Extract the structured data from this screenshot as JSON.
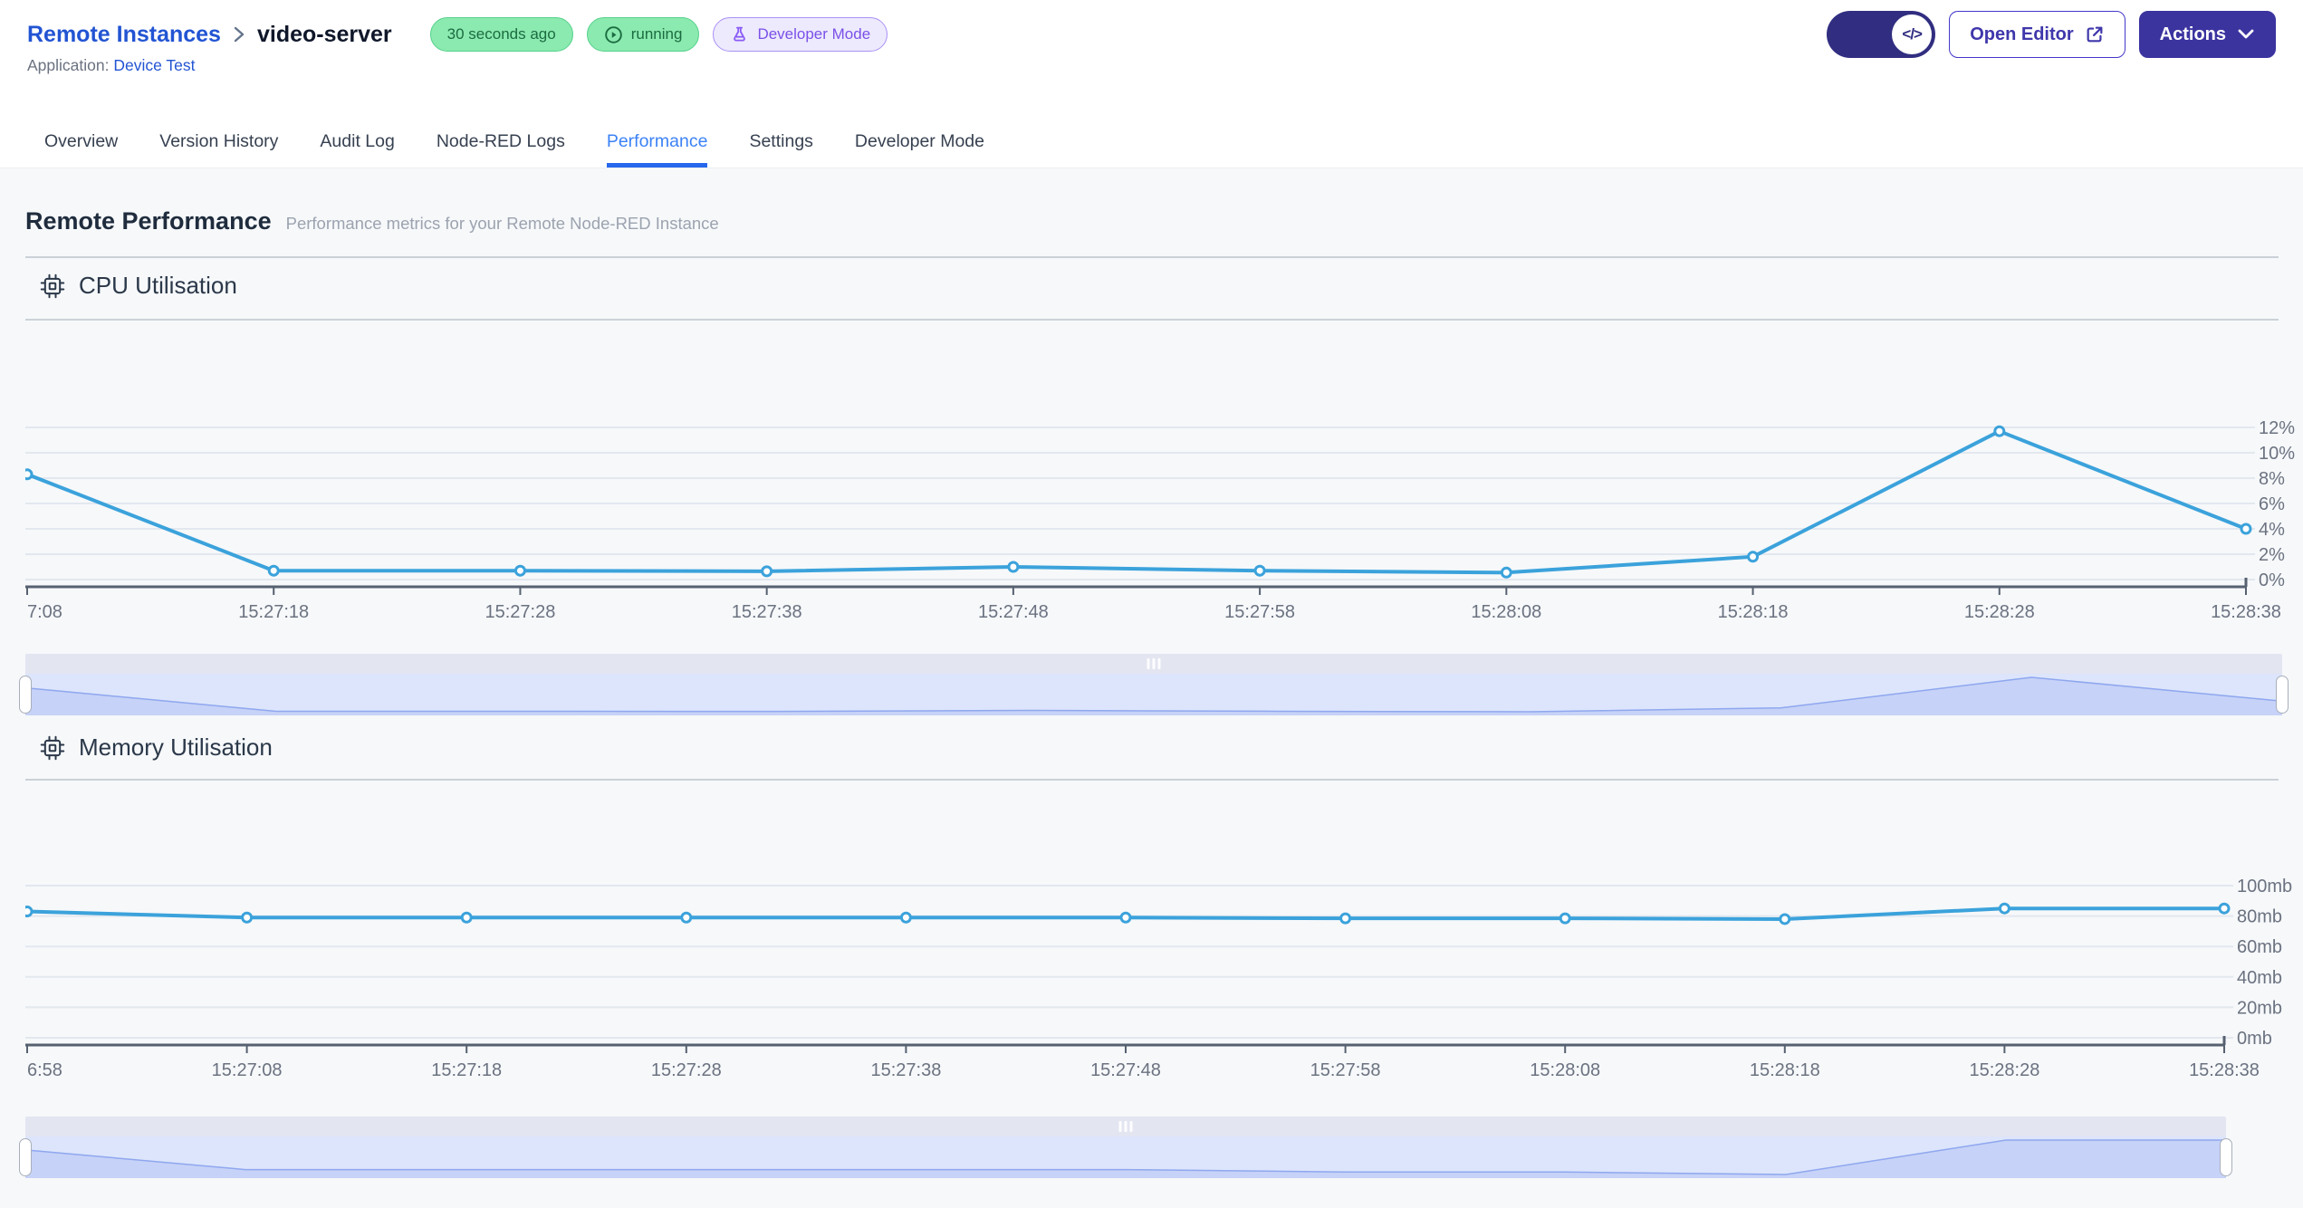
{
  "header": {
    "breadcrumb": {
      "parent": "Remote Instances",
      "current": "video-server"
    },
    "badges": {
      "last_seen": "30 seconds ago",
      "status": "running",
      "mode": "Developer Mode"
    },
    "application": {
      "label": "Application:",
      "name": "Device Test"
    },
    "controls": {
      "editor_toggle_icon": "</>",
      "open_editor": "Open Editor",
      "actions": "Actions"
    }
  },
  "tabs": [
    {
      "label": "Overview",
      "active": false
    },
    {
      "label": "Version History",
      "active": false
    },
    {
      "label": "Audit Log",
      "active": false
    },
    {
      "label": "Node-RED Logs",
      "active": false
    },
    {
      "label": "Performance",
      "active": true
    },
    {
      "label": "Settings",
      "active": false
    },
    {
      "label": "Developer Mode",
      "active": false
    }
  ],
  "page": {
    "title": "Remote Performance",
    "subtitle": "Performance metrics for your Remote Node-RED Instance"
  },
  "chart_data": [
    {
      "id": "cpu",
      "type": "line",
      "title": "CPU Utilisation",
      "unit": "%",
      "ylim": [
        0,
        12
      ],
      "y_ticks": [
        0,
        2,
        4,
        6,
        8,
        10,
        12
      ],
      "x": [
        "7:08",
        "15:27:18",
        "15:27:28",
        "15:27:38",
        "15:27:48",
        "15:27:58",
        "15:28:08",
        "15:28:18",
        "15:28:28",
        "15:28:38"
      ],
      "values": [
        8.3,
        0.7,
        0.7,
        0.65,
        1.0,
        0.7,
        0.55,
        1.8,
        11.7,
        4.0
      ],
      "grid": true,
      "legend": "none",
      "line_color": "#3BA2DB"
    },
    {
      "id": "memory",
      "type": "line",
      "title": "Memory Utilisation",
      "unit": "mb",
      "ylim": [
        0,
        100
      ],
      "y_ticks": [
        0,
        20,
        40,
        60,
        80,
        100
      ],
      "x": [
        "6:58",
        "15:27:08",
        "15:27:18",
        "15:27:28",
        "15:27:38",
        "15:27:48",
        "15:27:58",
        "15:28:08",
        "15:28:18",
        "15:28:28",
        "15:28:38"
      ],
      "values": [
        83,
        79,
        79,
        79,
        79,
        79,
        78.5,
        78.5,
        78,
        85,
        85
      ],
      "grid": true,
      "legend": "none",
      "line_color": "#3BA2DB"
    }
  ],
  "colors": {
    "accent_blue": "#2767EC",
    "link_blue": "#2254D3",
    "line_blue": "#3BA2DB",
    "badge_green_bg": "#8BEAAF",
    "badge_green_text": "#1B6C41",
    "badge_purple_text": "#7B50E8",
    "button_indigo": "#3B349F",
    "toggle_indigo": "#312E81",
    "content_bg": "#F6F8FA"
  }
}
